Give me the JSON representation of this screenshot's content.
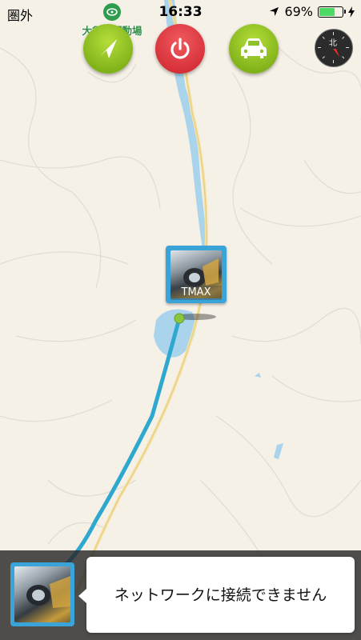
{
  "status_bar": {
    "carrier": "圏外",
    "time": "16:33",
    "battery_text": "69%",
    "battery_level": 0.69,
    "location_icon": "location-arrow-icon",
    "charging_icon": "charging-bolt-icon"
  },
  "map": {
    "poi_label": "大須賀運動場",
    "marker_caption": "TMAX",
    "colors": {
      "land": "#f6f1e7",
      "water": "#a9d4ec",
      "road": "#f5e2a8",
      "route": "#2fa8cf",
      "location_dot": "#8cc63f"
    }
  },
  "controls": {
    "navigate_icon": "navigation-arrow-icon",
    "power_icon": "power-icon",
    "vehicle_icon": "car-icon",
    "compass_icon": "compass-icon",
    "button_green": "#8fc12a",
    "button_red": "#e0404a"
  },
  "notification": {
    "message": "ネットワークに接続できません"
  }
}
